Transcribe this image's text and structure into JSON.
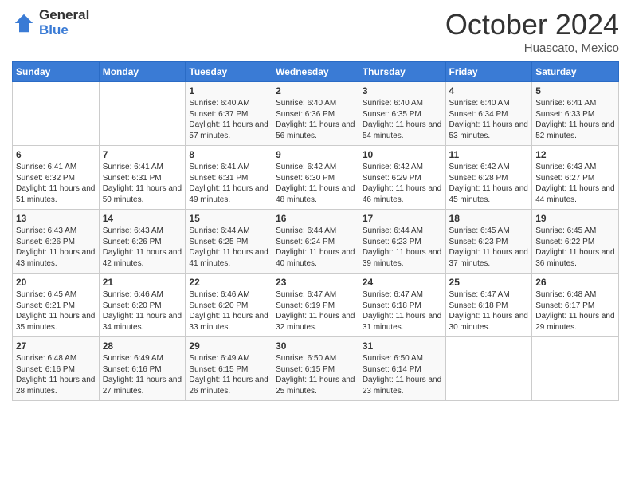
{
  "logo": {
    "general": "General",
    "blue": "Blue"
  },
  "header": {
    "month": "October 2024",
    "location": "Huascato, Mexico"
  },
  "days_of_week": [
    "Sunday",
    "Monday",
    "Tuesday",
    "Wednesday",
    "Thursday",
    "Friday",
    "Saturday"
  ],
  "weeks": [
    [
      {
        "day": "",
        "sunrise": "",
        "sunset": "",
        "daylight": ""
      },
      {
        "day": "",
        "sunrise": "",
        "sunset": "",
        "daylight": ""
      },
      {
        "day": "1",
        "sunrise": "Sunrise: 6:40 AM",
        "sunset": "Sunset: 6:37 PM",
        "daylight": "Daylight: 11 hours and 57 minutes."
      },
      {
        "day": "2",
        "sunrise": "Sunrise: 6:40 AM",
        "sunset": "Sunset: 6:36 PM",
        "daylight": "Daylight: 11 hours and 56 minutes."
      },
      {
        "day": "3",
        "sunrise": "Sunrise: 6:40 AM",
        "sunset": "Sunset: 6:35 PM",
        "daylight": "Daylight: 11 hours and 54 minutes."
      },
      {
        "day": "4",
        "sunrise": "Sunrise: 6:40 AM",
        "sunset": "Sunset: 6:34 PM",
        "daylight": "Daylight: 11 hours and 53 minutes."
      },
      {
        "day": "5",
        "sunrise": "Sunrise: 6:41 AM",
        "sunset": "Sunset: 6:33 PM",
        "daylight": "Daylight: 11 hours and 52 minutes."
      }
    ],
    [
      {
        "day": "6",
        "sunrise": "Sunrise: 6:41 AM",
        "sunset": "Sunset: 6:32 PM",
        "daylight": "Daylight: 11 hours and 51 minutes."
      },
      {
        "day": "7",
        "sunrise": "Sunrise: 6:41 AM",
        "sunset": "Sunset: 6:31 PM",
        "daylight": "Daylight: 11 hours and 50 minutes."
      },
      {
        "day": "8",
        "sunrise": "Sunrise: 6:41 AM",
        "sunset": "Sunset: 6:31 PM",
        "daylight": "Daylight: 11 hours and 49 minutes."
      },
      {
        "day": "9",
        "sunrise": "Sunrise: 6:42 AM",
        "sunset": "Sunset: 6:30 PM",
        "daylight": "Daylight: 11 hours and 48 minutes."
      },
      {
        "day": "10",
        "sunrise": "Sunrise: 6:42 AM",
        "sunset": "Sunset: 6:29 PM",
        "daylight": "Daylight: 11 hours and 46 minutes."
      },
      {
        "day": "11",
        "sunrise": "Sunrise: 6:42 AM",
        "sunset": "Sunset: 6:28 PM",
        "daylight": "Daylight: 11 hours and 45 minutes."
      },
      {
        "day": "12",
        "sunrise": "Sunrise: 6:43 AM",
        "sunset": "Sunset: 6:27 PM",
        "daylight": "Daylight: 11 hours and 44 minutes."
      }
    ],
    [
      {
        "day": "13",
        "sunrise": "Sunrise: 6:43 AM",
        "sunset": "Sunset: 6:26 PM",
        "daylight": "Daylight: 11 hours and 43 minutes."
      },
      {
        "day": "14",
        "sunrise": "Sunrise: 6:43 AM",
        "sunset": "Sunset: 6:26 PM",
        "daylight": "Daylight: 11 hours and 42 minutes."
      },
      {
        "day": "15",
        "sunrise": "Sunrise: 6:44 AM",
        "sunset": "Sunset: 6:25 PM",
        "daylight": "Daylight: 11 hours and 41 minutes."
      },
      {
        "day": "16",
        "sunrise": "Sunrise: 6:44 AM",
        "sunset": "Sunset: 6:24 PM",
        "daylight": "Daylight: 11 hours and 40 minutes."
      },
      {
        "day": "17",
        "sunrise": "Sunrise: 6:44 AM",
        "sunset": "Sunset: 6:23 PM",
        "daylight": "Daylight: 11 hours and 39 minutes."
      },
      {
        "day": "18",
        "sunrise": "Sunrise: 6:45 AM",
        "sunset": "Sunset: 6:23 PM",
        "daylight": "Daylight: 11 hours and 37 minutes."
      },
      {
        "day": "19",
        "sunrise": "Sunrise: 6:45 AM",
        "sunset": "Sunset: 6:22 PM",
        "daylight": "Daylight: 11 hours and 36 minutes."
      }
    ],
    [
      {
        "day": "20",
        "sunrise": "Sunrise: 6:45 AM",
        "sunset": "Sunset: 6:21 PM",
        "daylight": "Daylight: 11 hours and 35 minutes."
      },
      {
        "day": "21",
        "sunrise": "Sunrise: 6:46 AM",
        "sunset": "Sunset: 6:20 PM",
        "daylight": "Daylight: 11 hours and 34 minutes."
      },
      {
        "day": "22",
        "sunrise": "Sunrise: 6:46 AM",
        "sunset": "Sunset: 6:20 PM",
        "daylight": "Daylight: 11 hours and 33 minutes."
      },
      {
        "day": "23",
        "sunrise": "Sunrise: 6:47 AM",
        "sunset": "Sunset: 6:19 PM",
        "daylight": "Daylight: 11 hours and 32 minutes."
      },
      {
        "day": "24",
        "sunrise": "Sunrise: 6:47 AM",
        "sunset": "Sunset: 6:18 PM",
        "daylight": "Daylight: 11 hours and 31 minutes."
      },
      {
        "day": "25",
        "sunrise": "Sunrise: 6:47 AM",
        "sunset": "Sunset: 6:18 PM",
        "daylight": "Daylight: 11 hours and 30 minutes."
      },
      {
        "day": "26",
        "sunrise": "Sunrise: 6:48 AM",
        "sunset": "Sunset: 6:17 PM",
        "daylight": "Daylight: 11 hours and 29 minutes."
      }
    ],
    [
      {
        "day": "27",
        "sunrise": "Sunrise: 6:48 AM",
        "sunset": "Sunset: 6:16 PM",
        "daylight": "Daylight: 11 hours and 28 minutes."
      },
      {
        "day": "28",
        "sunrise": "Sunrise: 6:49 AM",
        "sunset": "Sunset: 6:16 PM",
        "daylight": "Daylight: 11 hours and 27 minutes."
      },
      {
        "day": "29",
        "sunrise": "Sunrise: 6:49 AM",
        "sunset": "Sunset: 6:15 PM",
        "daylight": "Daylight: 11 hours and 26 minutes."
      },
      {
        "day": "30",
        "sunrise": "Sunrise: 6:50 AM",
        "sunset": "Sunset: 6:15 PM",
        "daylight": "Daylight: 11 hours and 25 minutes."
      },
      {
        "day": "31",
        "sunrise": "Sunrise: 6:50 AM",
        "sunset": "Sunset: 6:14 PM",
        "daylight": "Daylight: 11 hours and 23 minutes."
      },
      {
        "day": "",
        "sunrise": "",
        "sunset": "",
        "daylight": ""
      },
      {
        "day": "",
        "sunrise": "",
        "sunset": "",
        "daylight": ""
      }
    ]
  ]
}
